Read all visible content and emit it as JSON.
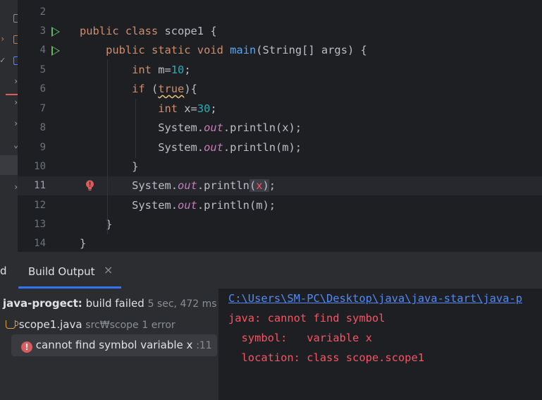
{
  "editor": {
    "lines": [
      {
        "num": "2",
        "code": ""
      },
      {
        "num": "3",
        "code": "public class scope1 {"
      },
      {
        "num": "4",
        "code": "    public static void main(String[] args) {"
      },
      {
        "num": "5",
        "code": "        int m=10;"
      },
      {
        "num": "6",
        "code": "        if (true){"
      },
      {
        "num": "7",
        "code": "            int x=30;"
      },
      {
        "num": "8",
        "code": "            System.out.println(x);"
      },
      {
        "num": "9",
        "code": "            System.out.println(m);"
      },
      {
        "num": "10",
        "code": "        }"
      },
      {
        "num": "11",
        "code": "        System.out.println(x);"
      },
      {
        "num": "12",
        "code": "        System.out.println(m);"
      },
      {
        "num": "13",
        "code": "    }"
      },
      {
        "num": "14",
        "code": "}"
      }
    ],
    "current_line": "11"
  },
  "bottom_panel": {
    "left_tab_stub": "d",
    "tab_label": "Build Output",
    "close_glyph": "×",
    "tree": {
      "project": "java-progect:",
      "status": "build failed",
      "duration": "5 sec, 472 ms",
      "file": "scope1.java",
      "file_path": "src₩scope",
      "file_errors": "1 error",
      "error_message": "cannot find symbol variable x",
      "error_line": ":11"
    },
    "console": {
      "path": "C:\\Users\\SM-PC\\Desktop\\java\\java-start\\java-p",
      "error": "java: cannot find symbol",
      "symbol": "  symbol:   variable x",
      "location": "  location: class scope.scope1"
    }
  },
  "colors": {
    "accent": "#3574f0",
    "error": "#f75464",
    "keyword": "#cf8e6d",
    "function": "#56a8f5",
    "number": "#2aacb8",
    "static_member": "#c77dbb"
  }
}
